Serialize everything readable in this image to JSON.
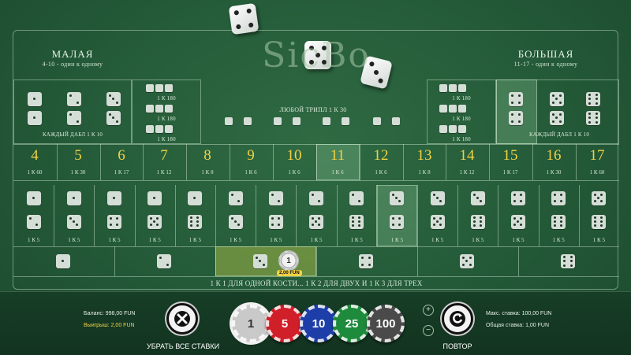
{
  "logo": {
    "text": "SicBo",
    "badge": "B"
  },
  "small_bet": {
    "title": "МАЛАЯ",
    "sub": "4-10 - один к одному"
  },
  "big_bet": {
    "title": "БОЛЬШАЯ",
    "sub": "11-17 - один к одному"
  },
  "double_label": "КАЖДЫЙ ДАБЛ 1 К 10",
  "triple_odds": "1 К 180",
  "any_triple": "ЛЮБОЙ ТРИПЛ 1 К 30",
  "totals": [
    {
      "n": "4",
      "odds": "1 К 60"
    },
    {
      "n": "5",
      "odds": "1 К 30"
    },
    {
      "n": "6",
      "odds": "1 К 17"
    },
    {
      "n": "7",
      "odds": "1 К 12"
    },
    {
      "n": "8",
      "odds": "1 К 8"
    },
    {
      "n": "9",
      "odds": "1 К 6"
    },
    {
      "n": "10",
      "odds": "1 К 6"
    },
    {
      "n": "11",
      "odds": "1 К 6"
    },
    {
      "n": "12",
      "odds": "1 К 6"
    },
    {
      "n": "13",
      "odds": "1 К 8"
    },
    {
      "n": "14",
      "odds": "1 К 12"
    },
    {
      "n": "15",
      "odds": "1 К 17"
    },
    {
      "n": "16",
      "odds": "1 К 30"
    },
    {
      "n": "17",
      "odds": "1 К 60"
    }
  ],
  "combo_odds": "1 К 5",
  "single_rule": "1 К 1 ДЛЯ ОДНОЙ КОСТИ... 1 К 2 ДЛЯ ДВУХ И 1 К 3 ДЛЯ ТРЕХ",
  "table_chip": {
    "value": "1",
    "badge": "2,00 FUN"
  },
  "balance": "Баланс: 998,00 FUN",
  "win": "Выигрыш: 2,00 FUN",
  "clear_all": "УБРАТЬ ВСЕ СТАВКИ",
  "repeat": "ПОВТОР",
  "max_bet": "Макс. ставка: 100,00 FUN",
  "total_bet": "Общая ставка: 1,00 FUN",
  "chips": [
    {
      "value": "1",
      "color": "#c9c9c9"
    },
    {
      "value": "5",
      "color": "#d11f2a"
    },
    {
      "value": "10",
      "color": "#1d3ea8"
    },
    {
      "value": "25",
      "color": "#1e8a3c"
    },
    {
      "value": "100",
      "color": "#4a4a4a"
    }
  ],
  "plus": "+",
  "minus": "−"
}
